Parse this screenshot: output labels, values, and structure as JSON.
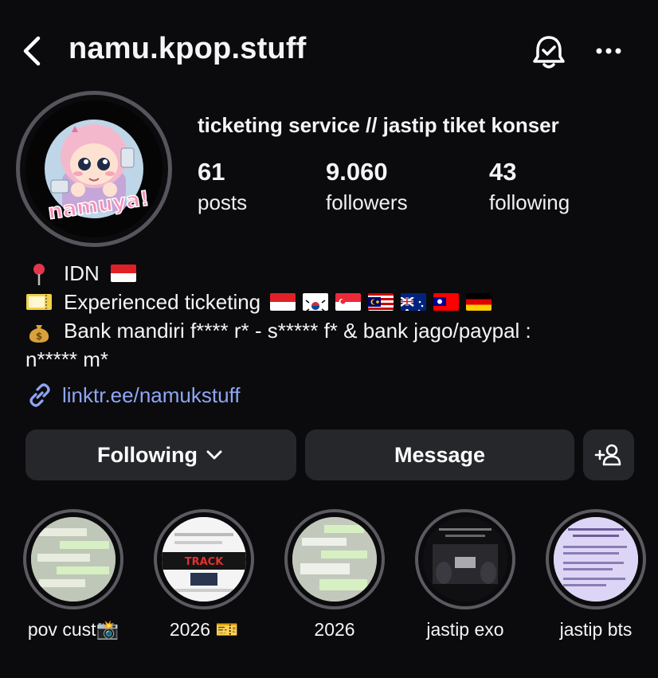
{
  "header": {
    "username": "namu.kpop.stuff",
    "back_icon": "chevron-left-icon",
    "bell_icon": "bell-check-icon",
    "more_icon": "more-horizontal-icon"
  },
  "profile": {
    "display_name": "ticketing service // jastip tiket konser",
    "avatar_text": "namuya!",
    "stats": [
      {
        "value": "61",
        "label": "posts"
      },
      {
        "value": "9.060",
        "label": "followers"
      },
      {
        "value": "43",
        "label": "following"
      }
    ]
  },
  "bio": {
    "line1": "IDN",
    "line2": "Experienced ticketing",
    "line3a": "Bank mandiri f**** r* - s***** f* & bank jago/paypal :",
    "line3b": "n***** m*",
    "ticket_emoji_text": "CONCERT TICKET",
    "flags": [
      "Indonesia",
      "South Korea",
      "Singapore",
      "Malaysia",
      "Australia",
      "Taiwan",
      "Germany"
    ]
  },
  "link": {
    "text": "linktr.ee/namukstuff"
  },
  "actions": {
    "following": "Following",
    "message": "Message"
  },
  "highlights": [
    {
      "label": "pov cust📸"
    },
    {
      "label": "2026 🎫"
    },
    {
      "label": "2026"
    },
    {
      "label": "jastip exo"
    },
    {
      "label": "jastip bts"
    }
  ],
  "colors": {
    "background": "#0b0b0d",
    "button": "#26272b",
    "link": "#8fa6f5",
    "ring": "#55555c"
  }
}
